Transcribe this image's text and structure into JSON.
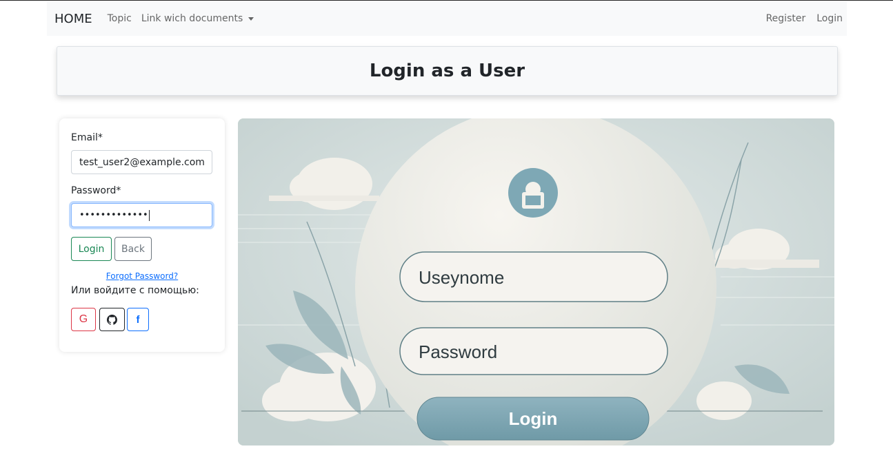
{
  "navbar": {
    "brand": "HOME",
    "links": [
      "Topic",
      "Link wich documents"
    ],
    "right_links": [
      "Register",
      "Login"
    ]
  },
  "header": {
    "title": "Login as a User"
  },
  "form": {
    "email_label": "Email*",
    "email_value": "test_user2@example.com",
    "password_label": "Password*",
    "password_mask": "•••••••••••••",
    "login_button": "Login",
    "back_button": "Back",
    "forgot_link": "Forgot Password?",
    "or_text": "Или войдите с помощью:",
    "social": {
      "google_glyph": "G",
      "facebook_glyph": "f",
      "icons": [
        "google-icon",
        "github-icon",
        "facebook-icon"
      ]
    }
  },
  "illustration": {
    "username_placeholder": "Useynome",
    "password_placeholder": "Password",
    "login_button": "Login"
  },
  "colors": {
    "success": "#198754",
    "secondary": "#6c757d",
    "danger": "#dc3545",
    "primary": "#0d6efd",
    "illustration_teal": "#7ea8b5"
  }
}
